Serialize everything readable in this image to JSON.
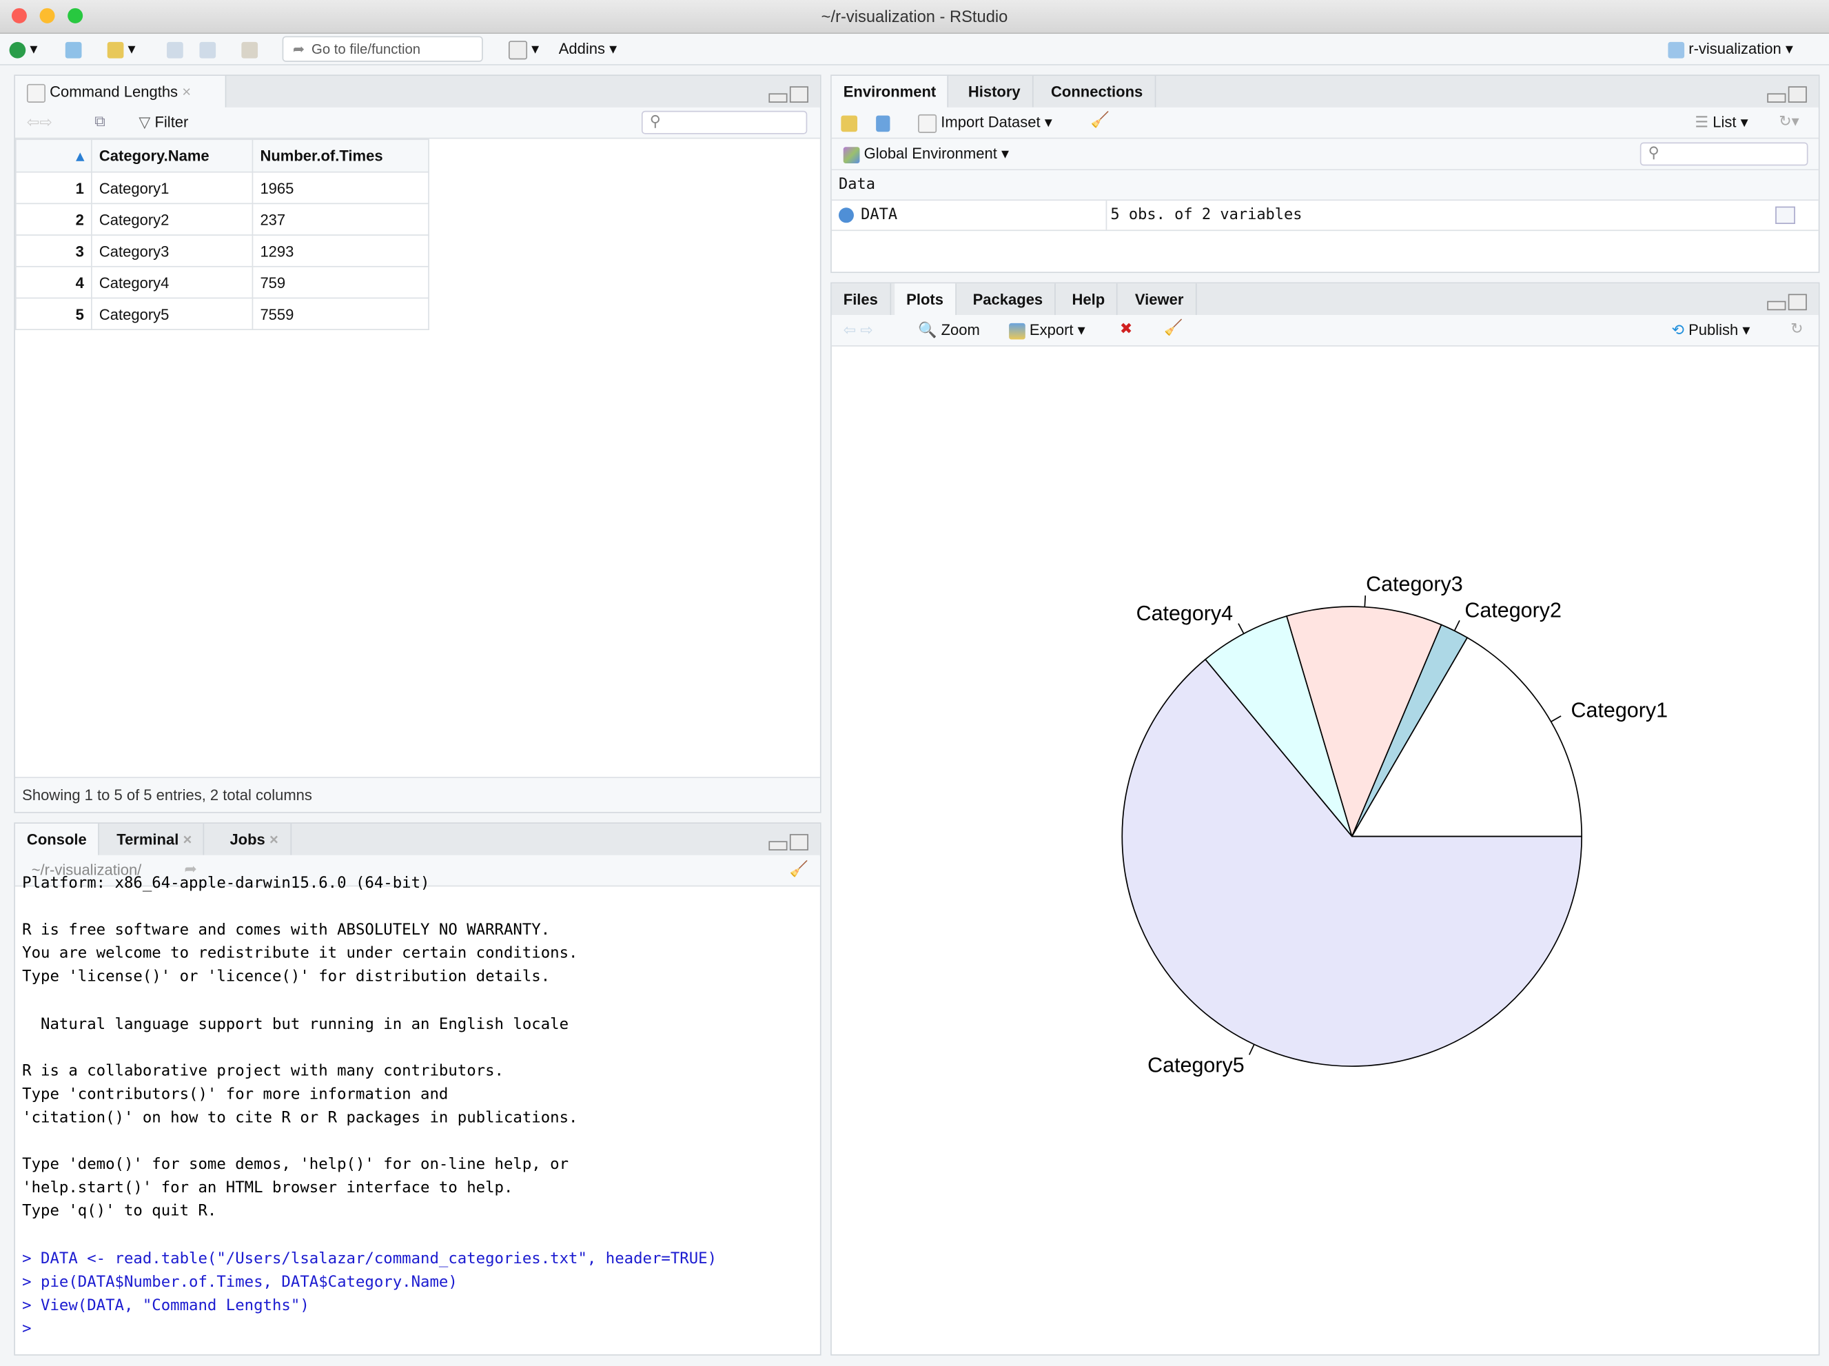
{
  "window": {
    "title": "~/r-visualization - RStudio"
  },
  "toolbar": {
    "goto_placeholder": "Go to file/function",
    "addins": "Addins",
    "project": "r-visualization"
  },
  "viewer": {
    "tab": "Command Lengths",
    "filter": "Filter",
    "columns": [
      "Category.Name",
      "Number.of.Times"
    ],
    "rows": [
      [
        "1",
        "Category1",
        "1965"
      ],
      [
        "2",
        "Category2",
        "237"
      ],
      [
        "3",
        "Category3",
        "1293"
      ],
      [
        "4",
        "Category4",
        "759"
      ],
      [
        "5",
        "Category5",
        "7559"
      ]
    ],
    "footer": "Showing 1 to 5 of 5 entries, 2 total columns"
  },
  "console": {
    "tabs": [
      "Console",
      "Terminal",
      "Jobs"
    ],
    "path": "~/r-visualization/",
    "lines": [
      {
        "t": "Platform: x86_64-apple-darwin15.6.0 (64-bit)",
        "c": false
      },
      {
        "t": "",
        "c": false
      },
      {
        "t": "R is free software and comes with ABSOLUTELY NO WARRANTY.",
        "c": false
      },
      {
        "t": "You are welcome to redistribute it under certain conditions.",
        "c": false
      },
      {
        "t": "Type 'license()' or 'licence()' for distribution details.",
        "c": false
      },
      {
        "t": "",
        "c": false
      },
      {
        "t": "  Natural language support but running in an English locale",
        "c": false
      },
      {
        "t": "",
        "c": false
      },
      {
        "t": "R is a collaborative project with many contributors.",
        "c": false
      },
      {
        "t": "Type 'contributors()' for more information and",
        "c": false
      },
      {
        "t": "'citation()' on how to cite R or R packages in publications.",
        "c": false
      },
      {
        "t": "",
        "c": false
      },
      {
        "t": "Type 'demo()' for some demos, 'help()' for on-line help, or",
        "c": false
      },
      {
        "t": "'help.start()' for an HTML browser interface to help.",
        "c": false
      },
      {
        "t": "Type 'q()' to quit R.",
        "c": false
      },
      {
        "t": "",
        "c": false
      },
      {
        "t": "> DATA <- read.table(\"/Users/lsalazar/command_categories.txt\", header=TRUE)",
        "c": true
      },
      {
        "t": "> pie(DATA$Number.of.Times, DATA$Category.Name)",
        "c": true
      },
      {
        "t": "> View(DATA, \"Command Lengths\")",
        "c": true
      },
      {
        "t": "> ",
        "c": true
      }
    ]
  },
  "environment": {
    "tabs": [
      "Environment",
      "History",
      "Connections"
    ],
    "import": "Import Dataset",
    "list": "List",
    "scope": "Global Environment",
    "section": "Data",
    "var_name": "DATA",
    "var_value": "5 obs. of 2 variables"
  },
  "files": {
    "tabs": [
      "Files",
      "Plots",
      "Packages",
      "Help",
      "Viewer"
    ],
    "zoom": "Zoom",
    "export": "Export",
    "publish": "Publish"
  },
  "chart_data": {
    "type": "pie",
    "categories": [
      "Category1",
      "Category2",
      "Category3",
      "Category4",
      "Category5"
    ],
    "values": [
      1965,
      237,
      1293,
      759,
      7559
    ],
    "colors": [
      "#ffffff",
      "#add8e6",
      "#ffe4e1",
      "#e0ffff",
      "#e6e6fa"
    ],
    "start": "3 o'clock, counter-clockwise"
  }
}
